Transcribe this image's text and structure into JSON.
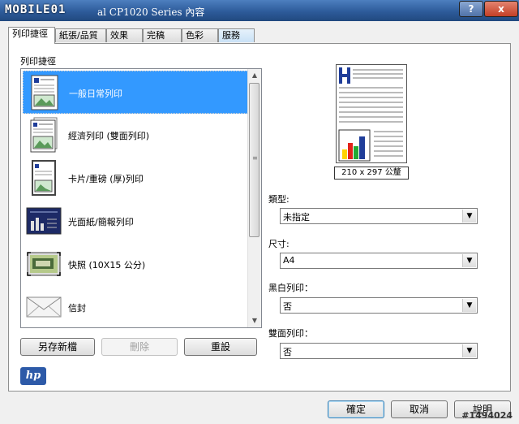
{
  "window": {
    "logo_text": "MOBILE01",
    "title": "al CP1020 Series 內容",
    "help_label": "?",
    "close_label": "x"
  },
  "tabs": [
    {
      "label": "列印捷徑"
    },
    {
      "label": "紙張/品質"
    },
    {
      "label": "效果"
    },
    {
      "label": "完稿"
    },
    {
      "label": "色彩"
    },
    {
      "label": "服務"
    }
  ],
  "shortcuts": {
    "section_label": "列印捷徑",
    "items": [
      {
        "label": "一般日常列印",
        "icon": "document-icon",
        "selected": true
      },
      {
        "label": "經濟列印 (雙面列印)",
        "icon": "duplex-document-icon",
        "selected": false
      },
      {
        "label": "卡片/重磅 (厚)列印",
        "icon": "card-document-icon",
        "selected": false
      },
      {
        "label": "光面紙/簡報列印",
        "icon": "glossy-presentation-icon",
        "selected": false
      },
      {
        "label": "快照 (10X15 公分)",
        "icon": "photo-icon",
        "selected": false
      },
      {
        "label": "信封",
        "icon": "envelope-icon",
        "selected": false
      }
    ]
  },
  "buttons": {
    "save_as": "另存新檔",
    "delete": "刪除",
    "reset": "重設",
    "ok": "確定",
    "cancel": "取消",
    "help": "說明"
  },
  "preview": {
    "size_label": "210 x 297 公釐"
  },
  "fields": {
    "type_label": "類型:",
    "type_value": "未指定",
    "size_label": "尺寸:",
    "size_value": "A4",
    "mono_label": "黑白列印：",
    "mono_value": "否",
    "duplex_label": "雙面列印：",
    "duplex_value": "否"
  },
  "brand": {
    "logo_text": "hp"
  },
  "watermark": "#1494024",
  "colors": {
    "selection": "#3399ff",
    "titlebar": "#2d5b9a"
  }
}
